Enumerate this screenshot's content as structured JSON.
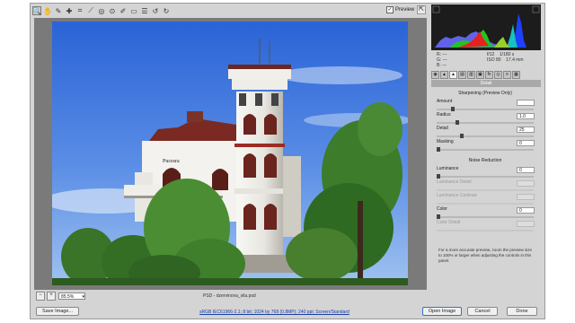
{
  "toolbar": {
    "tools": [
      "zoom-tool-icon",
      "hand-tool-icon",
      "white-balance-icon",
      "color-sampler-icon",
      "crop-icon",
      "straighten-icon",
      "spot-removal-icon",
      "red-eye-icon",
      "adjustment-brush-icon",
      "graduated-filter-icon",
      "preferences-icon",
      "rotate-left-icon",
      "rotate-right-icon"
    ],
    "tool_glyphs": [
      "🔍",
      "✋",
      "✎",
      "✚",
      "⌗",
      "⟋",
      "◎",
      "⊙",
      "✐",
      "▭",
      "☰",
      "↺",
      "↻"
    ],
    "preview_label": "Preview",
    "preview_checked": true
  },
  "histogram": {
    "colors": {
      "red": "#e82020",
      "green": "#22c422",
      "blue": "#1e40ff"
    }
  },
  "readout": {
    "r": "R:",
    "g": "G:",
    "b": "B:",
    "r_val": "---",
    "g_val": "---",
    "b_val": "---",
    "aperture": "f/12",
    "shutter": "1/180 s",
    "iso": "ISO 80",
    "focal": "17.4 mm"
  },
  "panel": {
    "title": "Detail",
    "sharpening_title": "Sharpening  (Preview Only)",
    "sharpening": [
      {
        "label": "Amount",
        "value": "",
        "pos": 0.15
      },
      {
        "label": "Radius",
        "value": "1.0",
        "pos": 0.2
      },
      {
        "label": "Detail",
        "value": "25",
        "pos": 0.25
      },
      {
        "label": "Masking",
        "value": "0",
        "pos": 0.0
      }
    ],
    "noise_title": "Noise Reduction",
    "noise": [
      {
        "label": "Luminance",
        "value": "0",
        "pos": 0.0,
        "disabled": false
      },
      {
        "label": "Luminance Detail",
        "value": "",
        "pos": 0.0,
        "disabled": true
      },
      {
        "label": "Luminance Contrast",
        "value": "",
        "pos": 0.0,
        "disabled": true
      },
      {
        "label": "Color",
        "value": "0",
        "pos": 0.0,
        "disabled": false
      },
      {
        "label": "Color Detail",
        "value": "",
        "pos": 0.0,
        "disabled": true
      }
    ],
    "note": "For a more accurate preview, zoom the preview size to 100% or larger when adjusting the controls in this panel."
  },
  "status": {
    "zoom_value": "85.5%",
    "filename": "PSD - dzervinova_vila.psd"
  },
  "photo": {
    "sign_text": "Pucesra"
  },
  "footer": {
    "save_label": "Save Image...",
    "workflow_link": "sRGB IEC61966-2.1; 8 bit; 1024 by 768 (0.8MP); 240 ppi; Screen/Standard",
    "open_label": "Open Image",
    "cancel_label": "Cancel",
    "done_label": "Done"
  }
}
